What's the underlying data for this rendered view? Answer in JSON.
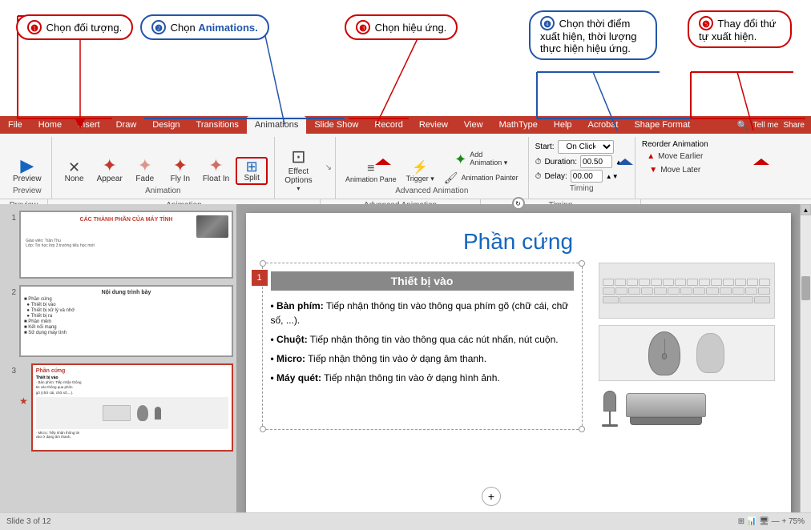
{
  "annotations": {
    "ann1": {
      "number": "❶",
      "text": "Chọn đối tượng."
    },
    "ann2": {
      "number": "❷",
      "text": "Chọn ",
      "blue_text": "Animations."
    },
    "ann3": {
      "number": "❸",
      "text": "Chọn hiệu ứng."
    },
    "ann4": {
      "number": "❹",
      "text": "Chọn thời điểm xuất hiện, thời lượng thực hiện hiệu ứng."
    },
    "ann5": {
      "number": "❺",
      "text": "Thay đổi thứ tự xuất hiện."
    }
  },
  "ribbon": {
    "tabs": [
      "File",
      "Home",
      "Insert",
      "Draw",
      "Design",
      "Transitions",
      "Animations",
      "Slide Show",
      "Record",
      "Review",
      "View",
      "MathType",
      "Help",
      "Acrobat",
      "Shape Format"
    ],
    "active_tab": "Animations",
    "tell_me_placeholder": "Tell me",
    "share_label": "Share",
    "groups": {
      "preview": {
        "label": "Preview",
        "buttons": [
          {
            "icon": "▶",
            "label": "Preview"
          }
        ]
      },
      "animation": {
        "label": "Animation",
        "buttons": [
          {
            "icon": "✕",
            "label": "None"
          },
          {
            "icon": "✦",
            "label": "Appear"
          },
          {
            "icon": "✦",
            "label": "Fade"
          },
          {
            "icon": "✦",
            "label": "Fly In"
          },
          {
            "icon": "✦",
            "label": "Float In"
          },
          {
            "icon": "⊞",
            "label": "Split",
            "active": true
          }
        ]
      },
      "effect_options": {
        "label": "Effect\nOptions",
        "icon": "▾"
      },
      "advanced": {
        "label": "Advanced Animation",
        "buttons": [
          {
            "icon": "➕",
            "label": "Add\nAnimation"
          },
          {
            "icon": "≡",
            "label": "Animation\nPane"
          },
          {
            "icon": "⚡",
            "label": "Trigger"
          },
          {
            "icon": "🖌",
            "label": "Animation\nPainter"
          }
        ]
      },
      "timing": {
        "label": "Timing",
        "start_label": "Start:",
        "start_value": "On Click",
        "duration_label": "Duration:",
        "duration_value": "00.50",
        "delay_label": "Delay:",
        "delay_value": "00.00",
        "reorder_label": "Reorder Animation",
        "move_earlier": "Move Earlier",
        "move_later": "Move Later"
      }
    }
  },
  "slides": {
    "slide1": {
      "number": "1",
      "title": "CÁC THÀNH PHẦN CỦA MÁY TÍNH",
      "active": false
    },
    "slide2": {
      "number": "2",
      "title": "Nội dung trình bày",
      "active": false,
      "items": [
        "Phần cứng",
        "Thiết bị vào",
        "Thiết bị xử lý và nhớ",
        "Thiết bị ra",
        "Phần mềm",
        "Kết nối mạng",
        "Sử dụng máy tính"
      ]
    },
    "slide3": {
      "number": "3",
      "title": "Phần cứng",
      "active": true
    }
  },
  "main_slide": {
    "title": "Phần cứng",
    "section_heading": "Thiết bị vào",
    "content": [
      "• Bàn phím: Tiếp nhận thông tin vào thông qua phím gõ (chữ cái, chữ số, ...).",
      "• Chuột: Tiếp nhận thông tin vào thông qua các nút nhấn, nút cuộn.",
      "• Micro: Tiếp nhận thông tin vào ở dạng âm thanh.",
      "• Máy quét: Tiếp nhận thông tin vào ở dạng hình ảnh."
    ]
  }
}
